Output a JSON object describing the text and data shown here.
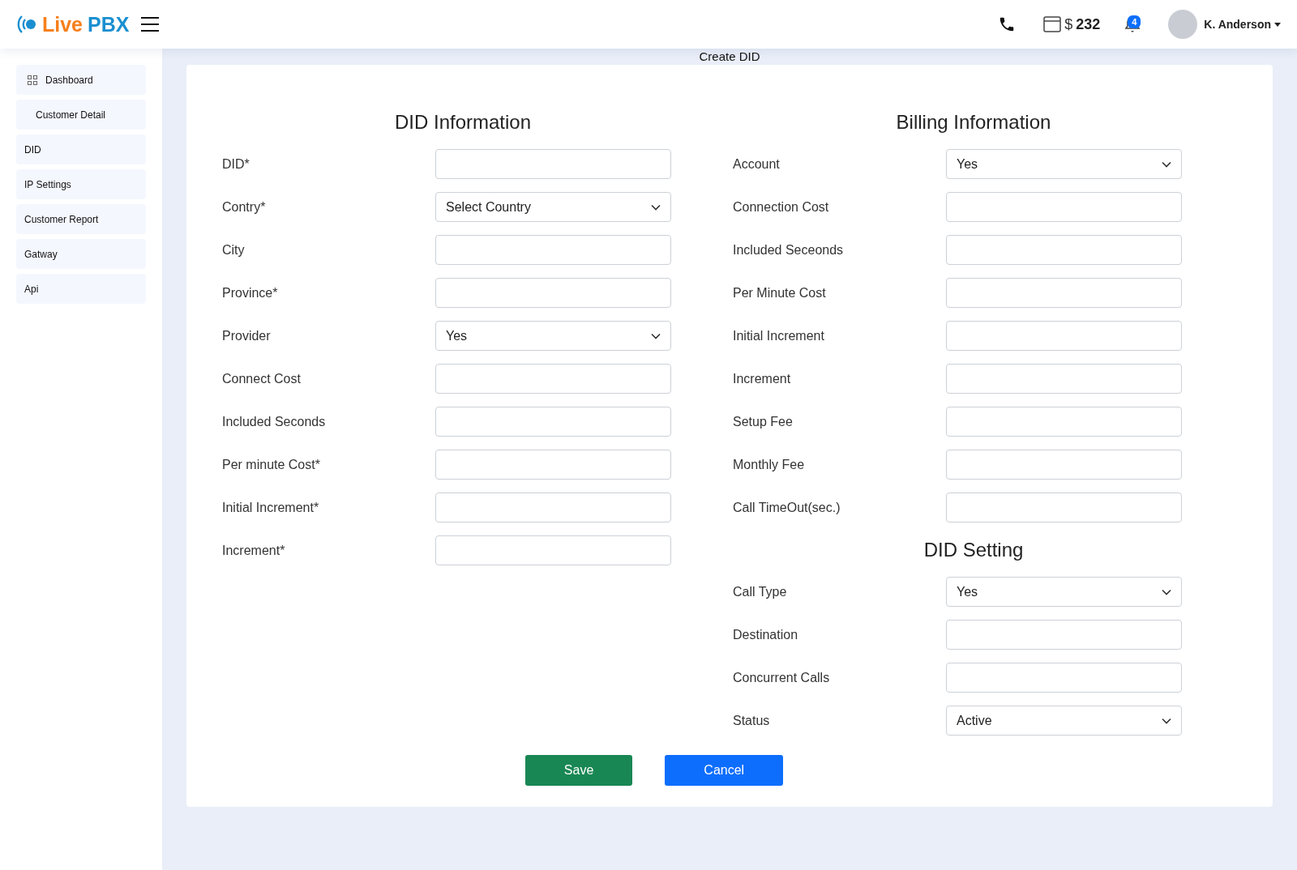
{
  "header": {
    "logo": {
      "word_1": "Live",
      "word_2": "PBX"
    },
    "balance": {
      "currency": "$",
      "amount": "232"
    },
    "notifications": {
      "count": "4"
    },
    "user": {
      "name": "K. Anderson"
    }
  },
  "sidebar": {
    "items": [
      {
        "label": "Dashboard",
        "kind": "with-icon"
      },
      {
        "label": "Customer Detail",
        "kind": "indented"
      },
      {
        "label": "DID",
        "kind": "plain"
      },
      {
        "label": "IP Settings",
        "kind": "plain"
      },
      {
        "label": "Customer Report",
        "kind": "plain"
      },
      {
        "label": "Gatway",
        "kind": "plain"
      },
      {
        "label": "Api",
        "kind": "plain"
      }
    ]
  },
  "page_title": "Create DID",
  "form": {
    "columns": [
      {
        "sections": [
          {
            "title": "DID Information",
            "fields": [
              {
                "label": "DID*",
                "kind": "input"
              },
              {
                "label": "Contry*",
                "kind": "select",
                "value": "Select Country"
              },
              {
                "label": "City",
                "kind": "input"
              },
              {
                "label": "Province*",
                "kind": "input"
              },
              {
                "label": "Provider",
                "kind": "select",
                "value": "Yes"
              },
              {
                "label": "Connect Cost",
                "kind": "input"
              },
              {
                "label": "Included Seconds",
                "kind": "input"
              },
              {
                "label": "Per minute Cost*",
                "kind": "input"
              },
              {
                "label": "Initial Increment*",
                "kind": "input"
              },
              {
                "label": "Increment*",
                "kind": "input"
              }
            ]
          }
        ]
      },
      {
        "sections": [
          {
            "title": "Billing Information",
            "fields": [
              {
                "label": "Account",
                "kind": "select",
                "value": "Yes"
              },
              {
                "label": "Connection Cost",
                "kind": "input"
              },
              {
                "label": "Included Seceonds",
                "kind": "input"
              },
              {
                "label": "Per Minute Cost",
                "kind": "input"
              },
              {
                "label": "Initial Increment",
                "kind": "input"
              },
              {
                "label": "Increment",
                "kind": "input"
              },
              {
                "label": "Setup Fee",
                "kind": "input"
              },
              {
                "label": "Monthly Fee",
                "kind": "input"
              },
              {
                "label": "Call TimeOut(sec.)",
                "kind": "input"
              }
            ]
          },
          {
            "title": "DID Setting",
            "fields": [
              {
                "label": "Call Type",
                "kind": "select",
                "value": "Yes"
              },
              {
                "label": "Destination",
                "kind": "input"
              },
              {
                "label": "Concurrent Calls",
                "kind": "input"
              },
              {
                "label": "Status",
                "kind": "select",
                "value": "Active"
              }
            ]
          }
        ]
      }
    ]
  },
  "buttons": [
    {
      "label": "Save",
      "kind": "primary"
    },
    {
      "label": "Cancel",
      "kind": "secondary"
    }
  ]
}
